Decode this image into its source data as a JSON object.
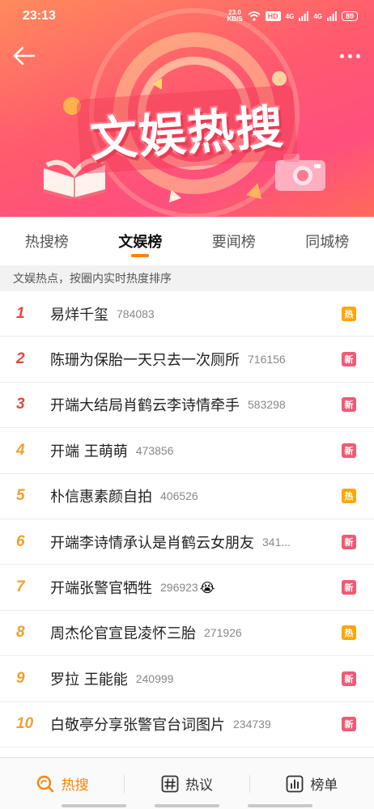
{
  "status": {
    "time": "23:13",
    "speed_value": "23.0",
    "speed_unit": "KB/S",
    "hd": "HD",
    "sig1": "4G",
    "sig2": "4G",
    "battery": "89"
  },
  "banner": {
    "title": "文娱热搜"
  },
  "tabs": [
    {
      "label": "热搜榜"
    },
    {
      "label": "文娱榜"
    },
    {
      "label": "要闻榜"
    },
    {
      "label": "同城榜"
    }
  ],
  "subtitle": "文娱热点，按圈内实时热度排序",
  "list": [
    {
      "rank": "1",
      "topic": "易烊千玺",
      "heat": "784083",
      "badge": "热",
      "badge_color": "#ffa500",
      "rank_color": "#e8473c"
    },
    {
      "rank": "2",
      "topic": "陈珊为保胎一天只去一次厕所",
      "heat": "716156",
      "badge": "新",
      "badge_color": "#f05a73",
      "rank_color": "#e8473c"
    },
    {
      "rank": "3",
      "topic": "开端大结局肖鹤云李诗情牵手",
      "heat": "583298",
      "badge": "新",
      "badge_color": "#f05a73",
      "rank_color": "#e8473c"
    },
    {
      "rank": "4",
      "topic": "开端 王萌萌",
      "heat": "473856",
      "badge": "新",
      "badge_color": "#f05a73",
      "rank_color": "#f0a030"
    },
    {
      "rank": "5",
      "topic": "朴信惠素颜自拍",
      "heat": "406526",
      "badge": "热",
      "badge_color": "#ffa500",
      "rank_color": "#f0a030"
    },
    {
      "rank": "6",
      "topic": "开端李诗情承认是肖鹤云女朋友",
      "heat": "341...",
      "badge": "新",
      "badge_color": "#f05a73",
      "rank_color": "#f0a030"
    },
    {
      "rank": "7",
      "topic": "开端张警官牺牲",
      "heat": "296923",
      "emoji": "😭",
      "badge": "新",
      "badge_color": "#f05a73",
      "rank_color": "#f0a030"
    },
    {
      "rank": "8",
      "topic": "周杰伦官宣昆凌怀三胎",
      "heat": "271926",
      "badge": "热",
      "badge_color": "#ffa500",
      "rank_color": "#f0a030"
    },
    {
      "rank": "9",
      "topic": "罗拉 王能能",
      "heat": "240999",
      "badge": "新",
      "badge_color": "#f05a73",
      "rank_color": "#f0a030"
    },
    {
      "rank": "10",
      "topic": "白敬亭分享张警官台词图片",
      "heat": "234739",
      "badge": "新",
      "badge_color": "#f05a73",
      "rank_color": "#f0a030"
    }
  ],
  "bottom_nav": [
    {
      "label": "热搜",
      "icon": "search-icon"
    },
    {
      "label": "热议",
      "icon": "hashtag-icon"
    },
    {
      "label": "榜单",
      "icon": "chart-icon"
    }
  ],
  "colors": {
    "accent": "#ff8200",
    "hot": "#ffa500",
    "new": "#f05a73"
  }
}
